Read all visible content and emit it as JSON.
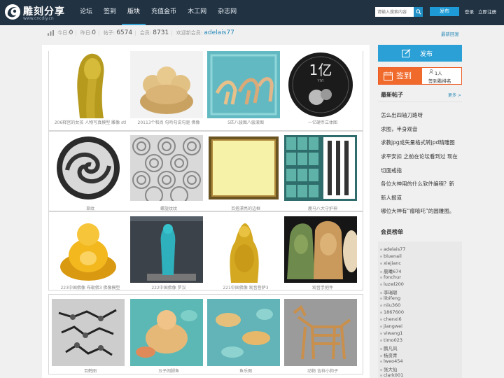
{
  "header": {
    "logo_text": "雕刻分享",
    "logo_url": "www.cncdiy.cn",
    "nav": [
      "论坛",
      "签到",
      "版块",
      "充值金币",
      "木工网",
      "杂志网"
    ],
    "nav_active": 2,
    "search_placeholder": "请输入搜索内容",
    "post_button": "发布",
    "login": "登录",
    "register": "立即注册"
  },
  "stats": {
    "today_label": "今日:",
    "today": "0",
    "yesterday_label": "昨日:",
    "yesterday": "0",
    "posts_label": "帖子:",
    "posts": "6574",
    "members_label": "会员:",
    "members": "8731",
    "welcome_label": "欢迎新会员:",
    "newest_member": "adelais77",
    "latest_reply": "最新回复"
  },
  "gallery": {
    "rows": [
      [
        "206释宫的女孩 人物写真模型 雕像 stl",
        "20113个和尚 勾听勾说勾驱 佛像",
        "5匹八骏图八骏滚图",
        "一亿硬币立体图"
      ],
      [
        "草纹",
        "螺旋纹纹",
        "百搭漂亮的边框",
        "鹿马八大守护神"
      ],
      [
        "223中国佛像 布勒佛3 佛像模型",
        "222中国佛像 罗汉",
        "221中国佛像 观音菩萨3",
        "观音手把件"
      ],
      [
        "百鹤图",
        "五子闹脚鱼",
        "鱼乐图",
        "动物 吉祥小狗子"
      ]
    ]
  },
  "sidebar": {
    "post_button": "发布",
    "checkin_label": "签到",
    "checkin_count": "1人",
    "checkin_rank": "签到看排名",
    "latest_title": "最新帖子",
    "more": "更多 >",
    "latest_posts": [
      "怎么出四轴刀路呀",
      "求图，半身观音",
      "求教jpg成矢量格式转jpd精雕图",
      "求平安扣 之前在论坛看到过 现在",
      "切面戒指",
      "各位大神用的什么软件编程？新",
      "新人报道",
      "哪位大神有“瘤嘻吒”的圆雕图。"
    ],
    "members_title": "会员榜单",
    "members": [
      "adelais77",
      "bluenail",
      "xiejianc",
      "晨曦674",
      "fonchur",
      "luzwl200",
      "李瑞聪",
      "libifeng",
      "niiu360",
      "1867600",
      "chenxi6",
      "jiangwei",
      "viwang1",
      "timo023",
      "鹏凡风",
      "杨资青",
      "lweo454",
      "张大仙",
      "clark001"
    ]
  },
  "colors": {
    "header_bg": "#213242",
    "accent_blue": "#2aa0d6",
    "checkin_orange": "#f06a2b"
  }
}
